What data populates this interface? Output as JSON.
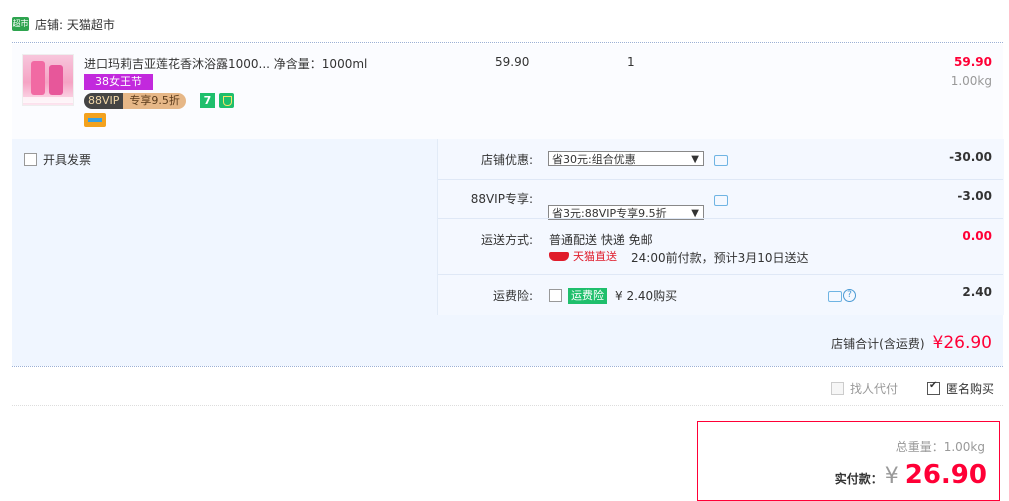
{
  "shop": {
    "badge": "超市",
    "label": "店铺: 天猫超市"
  },
  "item": {
    "title": "进口玛莉吉亚莲花香沐浴露1000...  净含量：1000ml",
    "tag_event": "38女王节",
    "vip_left": "88VIP",
    "vip_right": "专享9.5折",
    "tag_seven": "7",
    "price": "59.90",
    "qty": "1",
    "subtotal": "59.90",
    "weight": "1.00kg"
  },
  "invoice": {
    "label": "开具发票"
  },
  "options": {
    "shop_discount": {
      "label": "店铺优惠:",
      "selected": "省30元:组合优惠",
      "amount": "-30.00"
    },
    "vip": {
      "label": "88VIP专享:",
      "selected": "省3元:88VIP专享9.5折",
      "amount": "-3.00"
    },
    "shipping": {
      "label": "运送方式:",
      "method": "普通配送 快递 免邮",
      "tmall": "天猫直送",
      "note": "24:00前付款，预计3月10日送达",
      "amount": "0.00"
    },
    "insurance": {
      "label": "运费险:",
      "badge": "运费险",
      "price": "¥ 2.40购买",
      "amount": "2.40"
    }
  },
  "shop_total": {
    "label": "店铺合计(含运费)",
    "value": "¥26.90"
  },
  "extras": {
    "proxy_pay": "找人代付",
    "anonymous": "匿名购买"
  },
  "final": {
    "weight": "总重量：1.00kg",
    "pay_label": "实付款：",
    "currency": "¥",
    "amount": "26.90"
  },
  "colors": {
    "accent": "#ff0036",
    "option_bg": "#f0f6ff",
    "green": "#1fbf6c"
  }
}
